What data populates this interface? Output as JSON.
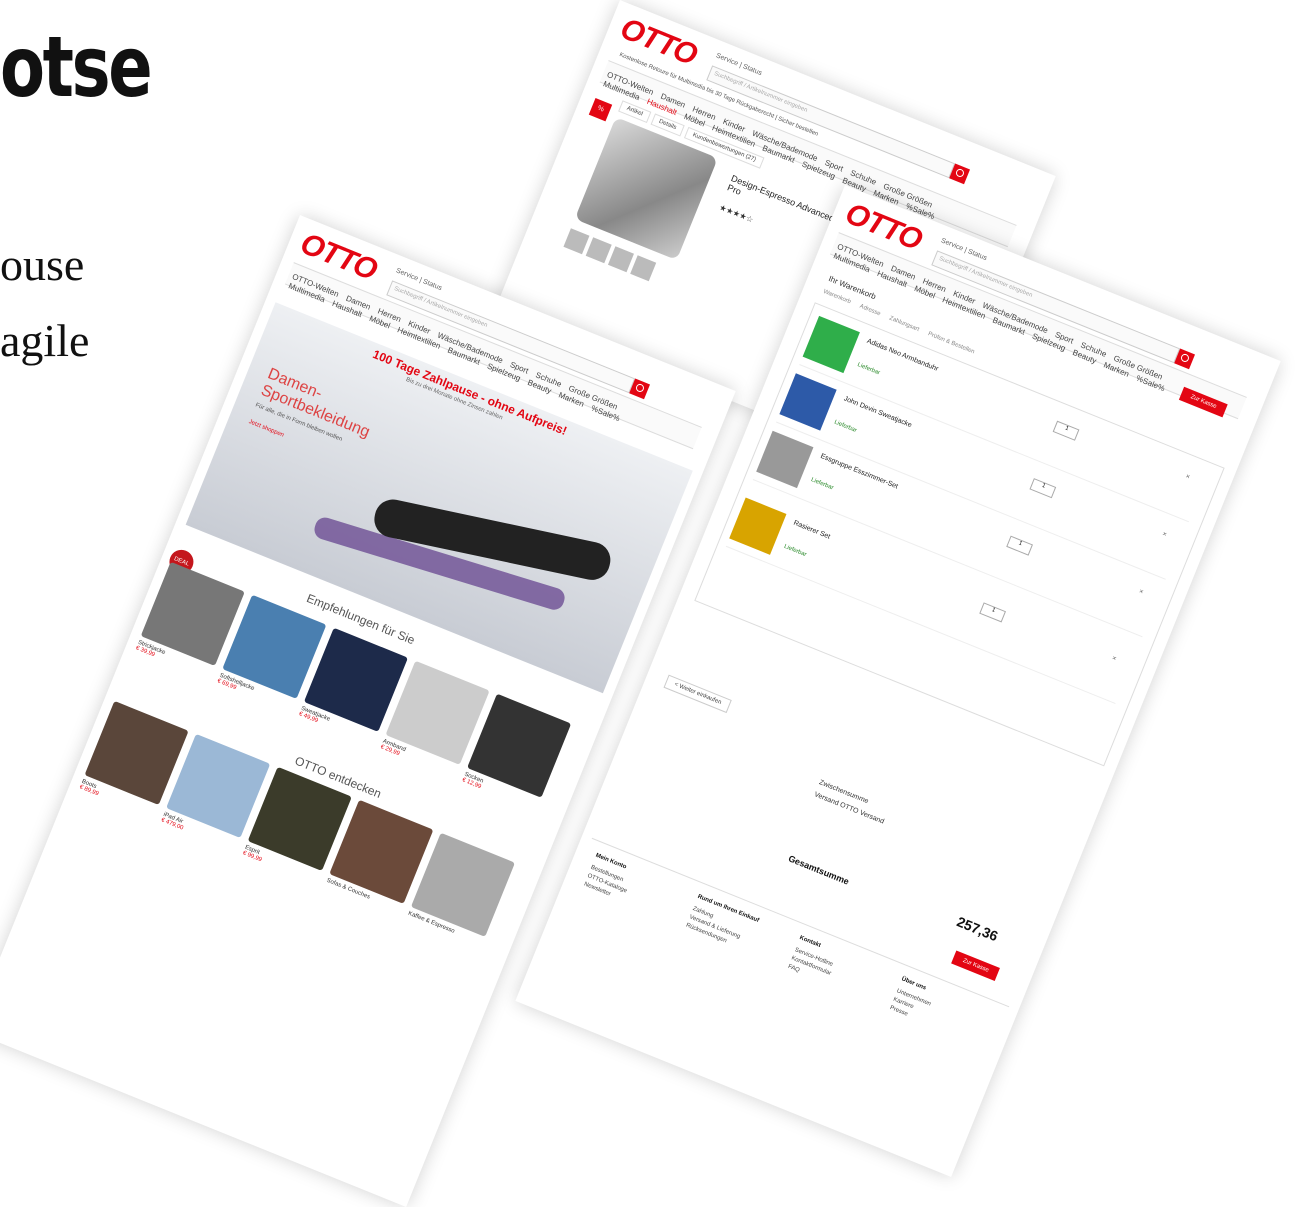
{
  "headline": "otse",
  "body_text": {
    "line1": "ouse",
    "line2": "agile"
  },
  "product_page": {
    "logo": "OTTO",
    "top_links": "Service | Status",
    "search_placeholder": "Suchbegriff / Artikelnummer eingeben",
    "shipping_note": "Kostenlose Retoure für Multimedia bis 30 Tage Rückgaberecht | Sicher bestellen",
    "nav_row1": [
      "OTTO-Welten",
      "Damen",
      "Herren",
      "Kinder",
      "Wäsche/Bademode",
      "Sport",
      "Schuhe",
      "Große Größen"
    ],
    "nav_row2": [
      "Multimedia",
      "Haushalt",
      "Möbel",
      "Heimtextilien",
      "Baumarkt",
      "Spielzeug",
      "Beauty",
      "Marken",
      "%Sale%"
    ],
    "tabs": [
      "Artikel",
      "Details",
      "Kundenbewertungen (27)"
    ],
    "sale_badge": "%",
    "product_title": "Design-Espresso Advanced Pro",
    "stars": "★★★★☆"
  },
  "home_page": {
    "logo": "OTTO",
    "top_links": "Service | Status",
    "search_placeholder": "Suchbegriff / Artikelnummer eingeben",
    "nav_row1": [
      "OTTO-Welten",
      "Damen",
      "Herren",
      "Kinder",
      "Wäsche/Bademode",
      "Sport",
      "Schuhe",
      "Große Größen"
    ],
    "nav_row2": [
      "Multimedia",
      "Haushalt",
      "Möbel",
      "Heimtextilien",
      "Baumarkt",
      "Spielzeug",
      "Beauty",
      "Marken",
      "%Sale%"
    ],
    "promo": "100 Tage Zahlpause - ohne Aufpreis!",
    "promo_sub": "Bis zu drei Monate ohne Zinsen zahlen",
    "hero_title": "Damen-Sportbekleidung",
    "hero_desc": "Für alle, die in Form bleiben wollen",
    "hero_more": "Jetzt shoppen",
    "deal_badge": "DEAL",
    "recommend_title": "Empfehlungen für Sie",
    "discover_title": "OTTO entdecken",
    "row1": [
      {
        "cap": "Strickjacke",
        "price": "€ 39,99"
      },
      {
        "cap": "Softshelljacke",
        "price": "€ 69,99"
      },
      {
        "cap": "Sweatjacke",
        "price": "€ 49,99"
      },
      {
        "cap": "Armband",
        "price": "€ 29,99"
      },
      {
        "cap": "Socken",
        "price": "€ 12,99"
      }
    ],
    "row2": [
      {
        "cap": "Boots",
        "price": "€ 89,99"
      },
      {
        "cap": "iPad Air",
        "price": "€ 479,00"
      },
      {
        "cap": "Esprit",
        "price": "€ 99,99"
      },
      {
        "cap": "Sofas & Couches",
        "price": ""
      },
      {
        "cap": "Kaffee & Espresso",
        "price": ""
      }
    ]
  },
  "cart_page": {
    "logo": "OTTO",
    "top_links": "Service | Status",
    "search_placeholder": "Suchbegriff / Artikelnummer eingeben",
    "nav_row1": [
      "OTTO-Welten",
      "Damen",
      "Herren",
      "Kinder",
      "Wäsche/Bademode",
      "Sport",
      "Schuhe",
      "Große Größen"
    ],
    "nav_row2": [
      "Multimedia",
      "Haushalt",
      "Möbel",
      "Heimtextilien",
      "Baumarkt",
      "Spielzeug",
      "Beauty",
      "Marken",
      "%Sale%"
    ],
    "cart_title": "Ihr Warenkorb",
    "steps": [
      "Warenkorb",
      "Adresse",
      "Zahlungsart",
      "Prüfen & Bestellen"
    ],
    "checkout_label": "Zur Kasse",
    "items": [
      {
        "name": "Adidas Neo Armbanduhr",
        "stock": "Lieferbar",
        "qty": "1",
        "price": "",
        "remove": "×"
      },
      {
        "name": "John Devin Sweatjacke",
        "stock": "Lieferbar",
        "qty": "1",
        "price": "",
        "remove": "×"
      },
      {
        "name": "Essgruppe Esszimmer-Set",
        "stock": "Lieferbar",
        "qty": "1",
        "price": "",
        "remove": "×"
      },
      {
        "name": "Rasierer Set",
        "stock": "Lieferbar",
        "qty": "1",
        "price": "",
        "remove": "×"
      }
    ],
    "continue_label": "< Weiter einkaufen",
    "summary": [
      {
        "label": "Zwischensumme",
        "value": ""
      },
      {
        "label": "Versand OTTO Versand",
        "value": ""
      }
    ],
    "total_label": "Gesamtsumme",
    "total_value": "257,36",
    "footer_cols": [
      {
        "title": "Mein Konto",
        "items": [
          "Bestellungen",
          "OTTO-Kataloge",
          "Newsletter"
        ]
      },
      {
        "title": "Rund um Ihren Einkauf",
        "items": [
          "Zahlung",
          "Versand & Lieferung",
          "Rücksendungen"
        ]
      },
      {
        "title": "Kontakt",
        "items": [
          "Service-Hotline",
          "Kontaktformular",
          "FAQ"
        ]
      },
      {
        "title": "Über uns",
        "items": [
          "Unternehmen",
          "Karriere",
          "Presse"
        ]
      }
    ]
  }
}
